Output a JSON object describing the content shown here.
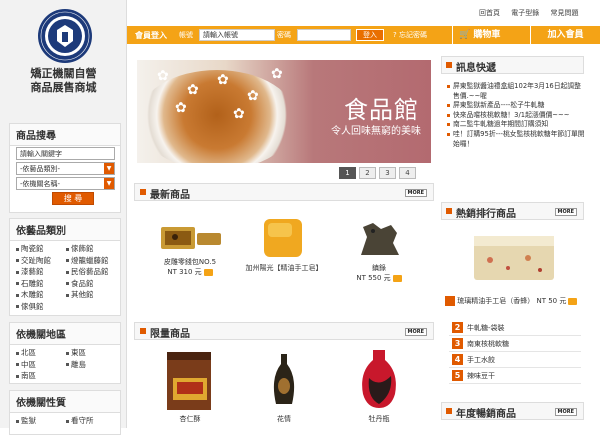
{
  "store": {
    "name_line1": "矯正機關自營",
    "name_line2": "商品展售商城",
    "logo_text": "MINISTRY OF JUSTICE · AGENCY OF CORRECTIONS"
  },
  "top_links": [
    "回首頁",
    "電子型錄",
    "常見問題"
  ],
  "login": {
    "title": "會員登入",
    "account_label": "帳號",
    "account_value": "請輸入帳號",
    "password_label": "密碼",
    "login_button": "登入",
    "forgot": "忘記密碼",
    "cart": "購物車",
    "join": "加入會員"
  },
  "search": {
    "title": "商品搜尋",
    "keyword_placeholder": "請輸入關鍵字",
    "category_select": "-依藝品類別-",
    "agency_select": "-依機關名稱-",
    "button": "搜 尋"
  },
  "categories": {
    "title": "依藝品類別",
    "items": [
      "陶瓷館",
      "傢飾館",
      "交趾陶館",
      "燈籠蠟藤館",
      "漆藝館",
      "民俗藝品館",
      "石雕館",
      "食品館",
      "木雕館",
      "其他館",
      "傢俱館"
    ]
  },
  "regions": {
    "title": "依機關地區",
    "items": [
      "北區",
      "東區",
      "中區",
      "離島",
      "南區"
    ]
  },
  "natures": {
    "title": "依機關性質",
    "items": [
      "監獄",
      "看守所"
    ]
  },
  "banner": {
    "title": "食品館",
    "subtitle": "令人回味無窮的美味"
  },
  "pager": [
    "1",
    "2",
    "3",
    "4"
  ],
  "more_label": "MORE",
  "new_products": {
    "title": "最新商品",
    "items": [
      {
        "name": "皮雕零錢包NO.5",
        "price": "NT 310 元"
      },
      {
        "name": "加州陽光【精油手工皂】",
        "price": ""
      },
      {
        "name": "鎮錄",
        "price": "NT 550 元"
      }
    ]
  },
  "limited_products": {
    "title": "限量商品",
    "items": [
      {
        "name": "杏仁酥"
      },
      {
        "name": "花情"
      },
      {
        "name": "牡丹瓶"
      }
    ]
  },
  "news": {
    "title": "訊息快遞",
    "items": [
      "屏東監獄醬油禮盒組102年3月16日起調整售價.~~喔",
      "屏東監獄新產品----松子牛軋糖",
      "快來品嚐核桃軟糖！3/1起漲價價~~~",
      "南二監牛軋糖過年期間訂購須知",
      "哇！訂購95折---桃女監核桃軟糖年節訂單開始囉！"
    ]
  },
  "hot": {
    "title": "熱銷排行商品",
    "top_name": "琉璃精油手工皂（香蜂）",
    "top_price": "NT 50 元",
    "ranks": [
      {
        "n": "2",
        "name": "牛軋糖-袋裝"
      },
      {
        "n": "3",
        "name": "南東核桃軟糖"
      },
      {
        "n": "4",
        "name": "手工水餃"
      },
      {
        "n": "5",
        "name": "辣味豆干"
      }
    ]
  },
  "annual": {
    "title": "年度暢銷商品"
  }
}
